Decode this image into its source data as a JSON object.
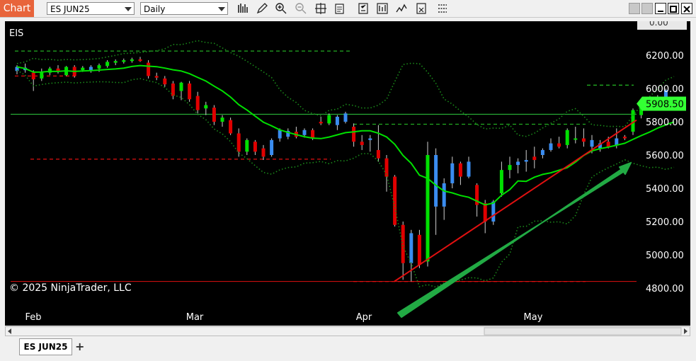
{
  "toolbar": {
    "chart_label": "Chart",
    "instrument": "ES JUN25",
    "interval": "Daily",
    "icons": [
      "bar-type-icon",
      "drawing-pencil-icon",
      "zoom-in-icon",
      "zoom-out-icon",
      "crosshair-icon",
      "data-box-icon",
      "properties-icon",
      "strategies-icon",
      "indicators-icon",
      "templates-icon",
      "grid-icon"
    ]
  },
  "chart": {
    "instrument_label": "EIS",
    "copyright": "© 2025 NinjaTrader, LLC",
    "last_price": "5908.50",
    "top_partial_label": "0.00",
    "price_ticks": [
      "6200.00",
      "6000.00",
      "5800.00",
      "5600.00",
      "5400.00",
      "5200.00",
      "5000.00",
      "4800.00"
    ],
    "month_labels": [
      "Feb",
      "Mar",
      "Apr",
      "May"
    ]
  },
  "tabs": {
    "instrument_tab": "ES JUN25",
    "add_tab": "+"
  },
  "colors": {
    "up_candle": "#00e000",
    "down_candle": "#e00000",
    "blue_candle": "#3a8cf0",
    "sma": "#00e000",
    "bollinger": "#1a8a1a",
    "arrow": "#22aa44"
  },
  "chart_data": {
    "type": "candlestick",
    "instrument": "ES JUN25",
    "y_ticks": [
      6200,
      6000,
      5800,
      5600,
      5400,
      5200,
      5000,
      4800
    ],
    "ylim": [
      4730,
      6280
    ],
    "x_labels": [
      "Feb",
      "Mar",
      "Apr",
      "May"
    ],
    "last_price": 5908.5,
    "horizontal_lines": [
      5845,
      4840
    ],
    "candles": [
      {
        "o": 6105,
        "h": 6140,
        "l": 6085,
        "c": 6130,
        "col": "blue"
      },
      {
        "o": 6125,
        "h": 6150,
        "l": 6095,
        "c": 6110,
        "col": "blue"
      },
      {
        "o": 6095,
        "h": 6110,
        "l": 5985,
        "c": 6055,
        "col": "red"
      },
      {
        "o": 6060,
        "h": 6120,
        "l": 6045,
        "c": 6100,
        "col": "green"
      },
      {
        "o": 6095,
        "h": 6130,
        "l": 6080,
        "c": 6120,
        "col": "green"
      },
      {
        "o": 6120,
        "h": 6140,
        "l": 6090,
        "c": 6100,
        "col": "red"
      },
      {
        "o": 6080,
        "h": 6135,
        "l": 6075,
        "c": 6130,
        "col": "green"
      },
      {
        "o": 6130,
        "h": 6140,
        "l": 6065,
        "c": 6075,
        "col": "red"
      },
      {
        "o": 6110,
        "h": 6135,
        "l": 6100,
        "c": 6125,
        "col": "green"
      },
      {
        "o": 6105,
        "h": 6140,
        "l": 6095,
        "c": 6130,
        "col": "blue"
      },
      {
        "o": 6120,
        "h": 6150,
        "l": 6100,
        "c": 6140,
        "col": "green"
      },
      {
        "o": 6135,
        "h": 6170,
        "l": 6125,
        "c": 6160,
        "col": "green"
      },
      {
        "o": 6155,
        "h": 6175,
        "l": 6140,
        "c": 6165,
        "col": "green"
      },
      {
        "o": 6160,
        "h": 6180,
        "l": 6150,
        "c": 6170,
        "col": "green"
      },
      {
        "o": 6165,
        "h": 6185,
        "l": 6155,
        "c": 6175,
        "col": "green"
      },
      {
        "o": 6175,
        "h": 6190,
        "l": 6160,
        "c": 6165,
        "col": "red"
      },
      {
        "o": 6155,
        "h": 6170,
        "l": 6060,
        "c": 6075,
        "col": "red"
      },
      {
        "o": 6075,
        "h": 6095,
        "l": 6050,
        "c": 6065,
        "col": "red"
      },
      {
        "o": 6060,
        "h": 6075,
        "l": 6010,
        "c": 6025,
        "col": "red"
      },
      {
        "o": 6030,
        "h": 6045,
        "l": 5935,
        "c": 5955,
        "col": "red"
      },
      {
        "o": 5985,
        "h": 6040,
        "l": 5930,
        "c": 6035,
        "col": "green"
      },
      {
        "o": 6030,
        "h": 6045,
        "l": 5920,
        "c": 5935,
        "col": "red"
      },
      {
        "o": 5955,
        "h": 5980,
        "l": 5850,
        "c": 5870,
        "col": "red"
      },
      {
        "o": 5880,
        "h": 5920,
        "l": 5840,
        "c": 5900,
        "col": "green"
      },
      {
        "o": 5885,
        "h": 5900,
        "l": 5780,
        "c": 5800,
        "col": "red"
      },
      {
        "o": 5800,
        "h": 5840,
        "l": 5770,
        "c": 5825,
        "col": "green"
      },
      {
        "o": 5810,
        "h": 5825,
        "l": 5720,
        "c": 5730,
        "col": "red"
      },
      {
        "o": 5730,
        "h": 5760,
        "l": 5590,
        "c": 5620,
        "col": "red"
      },
      {
        "o": 5620,
        "h": 5700,
        "l": 5600,
        "c": 5690,
        "col": "green"
      },
      {
        "o": 5680,
        "h": 5690,
        "l": 5600,
        "c": 5620,
        "col": "red"
      },
      {
        "o": 5640,
        "h": 5660,
        "l": 5570,
        "c": 5590,
        "col": "red"
      },
      {
        "o": 5600,
        "h": 5700,
        "l": 5590,
        "c": 5690,
        "col": "blue"
      },
      {
        "o": 5700,
        "h": 5760,
        "l": 5680,
        "c": 5750,
        "col": "blue"
      },
      {
        "o": 5710,
        "h": 5760,
        "l": 5695,
        "c": 5745,
        "col": "blue"
      },
      {
        "o": 5740,
        "h": 5770,
        "l": 5700,
        "c": 5710,
        "col": "red"
      },
      {
        "o": 5720,
        "h": 5760,
        "l": 5705,
        "c": 5750,
        "col": "blue"
      },
      {
        "o": 5750,
        "h": 5760,
        "l": 5690,
        "c": 5700,
        "col": "red"
      },
      {
        "o": 5800,
        "h": 5830,
        "l": 5780,
        "c": 5790,
        "col": "red"
      },
      {
        "o": 5790,
        "h": 5850,
        "l": 5780,
        "c": 5840,
        "col": "green"
      },
      {
        "o": 5830,
        "h": 5840,
        "l": 5750,
        "c": 5780,
        "col": "blue"
      },
      {
        "o": 5800,
        "h": 5860,
        "l": 5790,
        "c": 5850,
        "col": "blue"
      },
      {
        "o": 5770,
        "h": 5790,
        "l": 5650,
        "c": 5680,
        "col": "red"
      },
      {
        "o": 5680,
        "h": 5720,
        "l": 5630,
        "c": 5660,
        "col": "red"
      },
      {
        "o": 5700,
        "h": 5720,
        "l": 5620,
        "c": 5690,
        "col": "blue"
      },
      {
        "o": 5630,
        "h": 5780,
        "l": 5560,
        "c": 5580,
        "col": "red"
      },
      {
        "o": 5580,
        "h": 5600,
        "l": 5380,
        "c": 5470,
        "col": "red"
      },
      {
        "o": 5470,
        "h": 5480,
        "l": 5170,
        "c": 5180,
        "col": "red"
      },
      {
        "o": 5180,
        "h": 5200,
        "l": 4850,
        "c": 4950,
        "col": "red"
      },
      {
        "o": 4950,
        "h": 5150,
        "l": 4840,
        "c": 5130,
        "col": "blue"
      },
      {
        "o": 5120,
        "h": 5150,
        "l": 4920,
        "c": 4940,
        "col": "red"
      },
      {
        "o": 4960,
        "h": 5680,
        "l": 4930,
        "c": 5600,
        "col": "green"
      },
      {
        "o": 5600,
        "h": 5640,
        "l": 5120,
        "c": 5290,
        "col": "blue"
      },
      {
        "o": 5290,
        "h": 5460,
        "l": 5210,
        "c": 5430,
        "col": "blue"
      },
      {
        "o": 5430,
        "h": 5590,
        "l": 5400,
        "c": 5550,
        "col": "blue"
      },
      {
        "o": 5550,
        "h": 5560,
        "l": 5420,
        "c": 5470,
        "col": "red"
      },
      {
        "o": 5470,
        "h": 5590,
        "l": 5460,
        "c": 5560,
        "col": "blue"
      },
      {
        "o": 5420,
        "h": 5430,
        "l": 5230,
        "c": 5300,
        "col": "red"
      },
      {
        "o": 5310,
        "h": 5330,
        "l": 5130,
        "c": 5200,
        "col": "red"
      },
      {
        "o": 5200,
        "h": 5330,
        "l": 5180,
        "c": 5320,
        "col": "blue"
      },
      {
        "o": 5370,
        "h": 5560,
        "l": 5350,
        "c": 5510,
        "col": "green"
      },
      {
        "o": 5510,
        "h": 5590,
        "l": 5460,
        "c": 5540,
        "col": "green"
      },
      {
        "o": 5540,
        "h": 5580,
        "l": 5490,
        "c": 5560,
        "col": "blue"
      },
      {
        "o": 5560,
        "h": 5630,
        "l": 5500,
        "c": 5570,
        "col": "blue"
      },
      {
        "o": 5570,
        "h": 5650,
        "l": 5520,
        "c": 5590,
        "col": "red"
      },
      {
        "o": 5600,
        "h": 5640,
        "l": 5580,
        "c": 5630,
        "col": "blue"
      },
      {
        "o": 5630,
        "h": 5700,
        "l": 5620,
        "c": 5670,
        "col": "blue"
      },
      {
        "o": 5670,
        "h": 5710,
        "l": 5640,
        "c": 5650,
        "col": "red"
      },
      {
        "o": 5660,
        "h": 5760,
        "l": 5640,
        "c": 5750,
        "col": "green"
      },
      {
        "o": 5700,
        "h": 5770,
        "l": 5670,
        "c": 5700,
        "col": "green"
      },
      {
        "o": 5700,
        "h": 5760,
        "l": 5650,
        "c": 5680,
        "col": "red"
      },
      {
        "o": 5690,
        "h": 5720,
        "l": 5610,
        "c": 5650,
        "col": "blue"
      },
      {
        "o": 5640,
        "h": 5690,
        "l": 5620,
        "c": 5670,
        "col": "blue"
      },
      {
        "o": 5680,
        "h": 5710,
        "l": 5640,
        "c": 5650,
        "col": "red"
      },
      {
        "o": 5660,
        "h": 5760,
        "l": 5640,
        "c": 5700,
        "col": "blue"
      },
      {
        "o": 5700,
        "h": 5720,
        "l": 5690,
        "c": 5710,
        "col": "red"
      },
      {
        "o": 5740,
        "h": 5880,
        "l": 5720,
        "c": 5870,
        "col": "green"
      },
      {
        "o": 5840,
        "h": 5910,
        "l": 5820,
        "c": 5900,
        "col": "green"
      },
      {
        "o": 5910,
        "h": 5940,
        "l": 5890,
        "c": 5920,
        "col": "blue"
      },
      {
        "o": 5920,
        "h": 5960,
        "l": 5900,
        "c": 5940,
        "col": "blue"
      },
      {
        "o": 5950,
        "h": 6000,
        "l": 5930,
        "c": 5990,
        "col": "blue"
      },
      {
        "o": 5930,
        "h": 5950,
        "l": 5890,
        "c": 5910,
        "col": "blue"
      }
    ]
  }
}
